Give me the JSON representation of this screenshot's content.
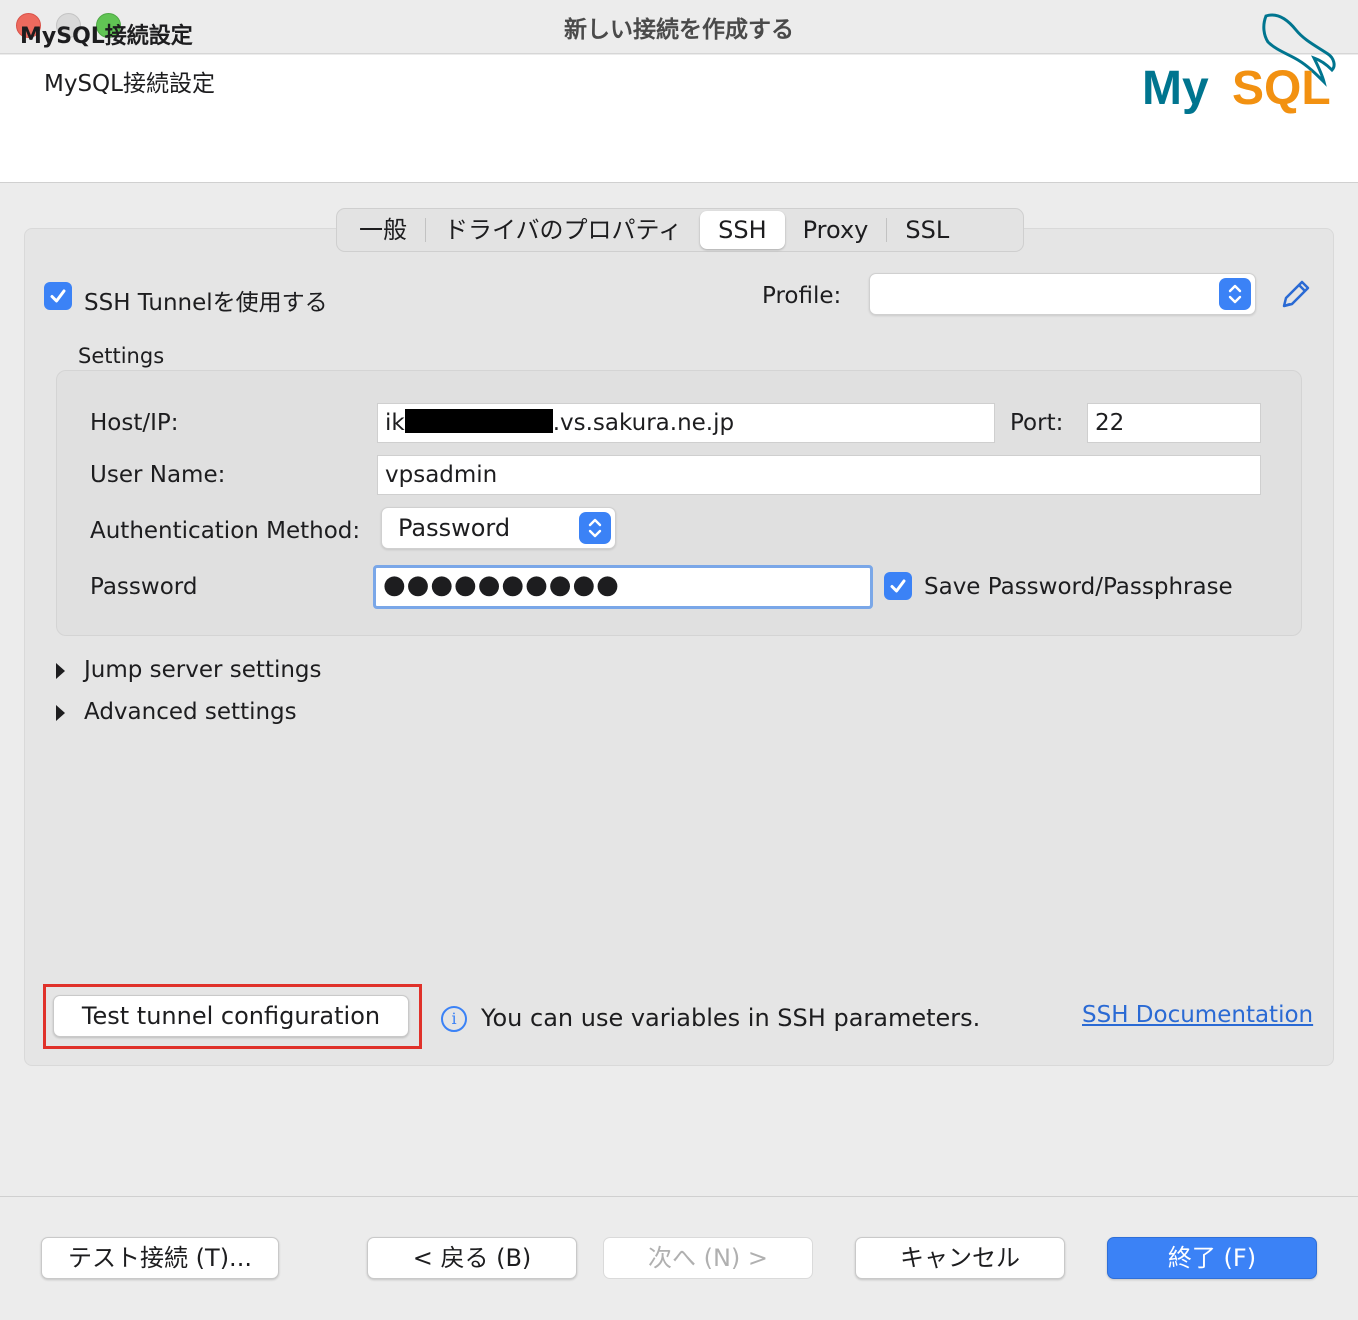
{
  "window": {
    "title": "新しい接続を作成する"
  },
  "header": {
    "title": "MySQL接続設定",
    "subtitle": "MySQL接続設定",
    "logo_text": "MySQL"
  },
  "tabs": [
    {
      "label": "一般",
      "active": false
    },
    {
      "label": "ドライバのプロパティ",
      "active": false
    },
    {
      "label": "SSH",
      "active": true
    },
    {
      "label": "Proxy",
      "active": false
    },
    {
      "label": "SSL",
      "active": false
    }
  ],
  "ssh": {
    "use_tunnel_label": "SSH Tunnelを使用する",
    "use_tunnel_checked": true,
    "profile_label": "Profile:",
    "profile_value": "",
    "settings_label": "Settings",
    "host_label": "Host/IP:",
    "host_prefix": "ik",
    "host_suffix": ".vs.sakura.ne.jp",
    "port_label": "Port:",
    "port_value": "22",
    "username_label": "User Name:",
    "username_value": "vpsadmin",
    "auth_label": "Authentication Method:",
    "auth_value": "Password",
    "password_label": "Password",
    "password_value": "●●●●●●●●●●",
    "save_password_label": "Save Password/Passphrase",
    "save_password_checked": true,
    "jump_server_label": "Jump server settings",
    "advanced_label": "Advanced settings",
    "test_tunnel_label": "Test tunnel configuration",
    "info_text": "You can use variables in SSH parameters.",
    "doc_link": "SSH Documentation"
  },
  "footer": {
    "test_connection": "テスト接続 (T)...",
    "back": "< 戻る (B)",
    "next": "次へ (N) >",
    "cancel": "キャンセル",
    "finish": "終了 (F)"
  },
  "colors": {
    "accent": "#3b82f6",
    "highlight_border": "#e0312a",
    "mysql_blue": "#00758f",
    "mysql_orange": "#f29111"
  }
}
